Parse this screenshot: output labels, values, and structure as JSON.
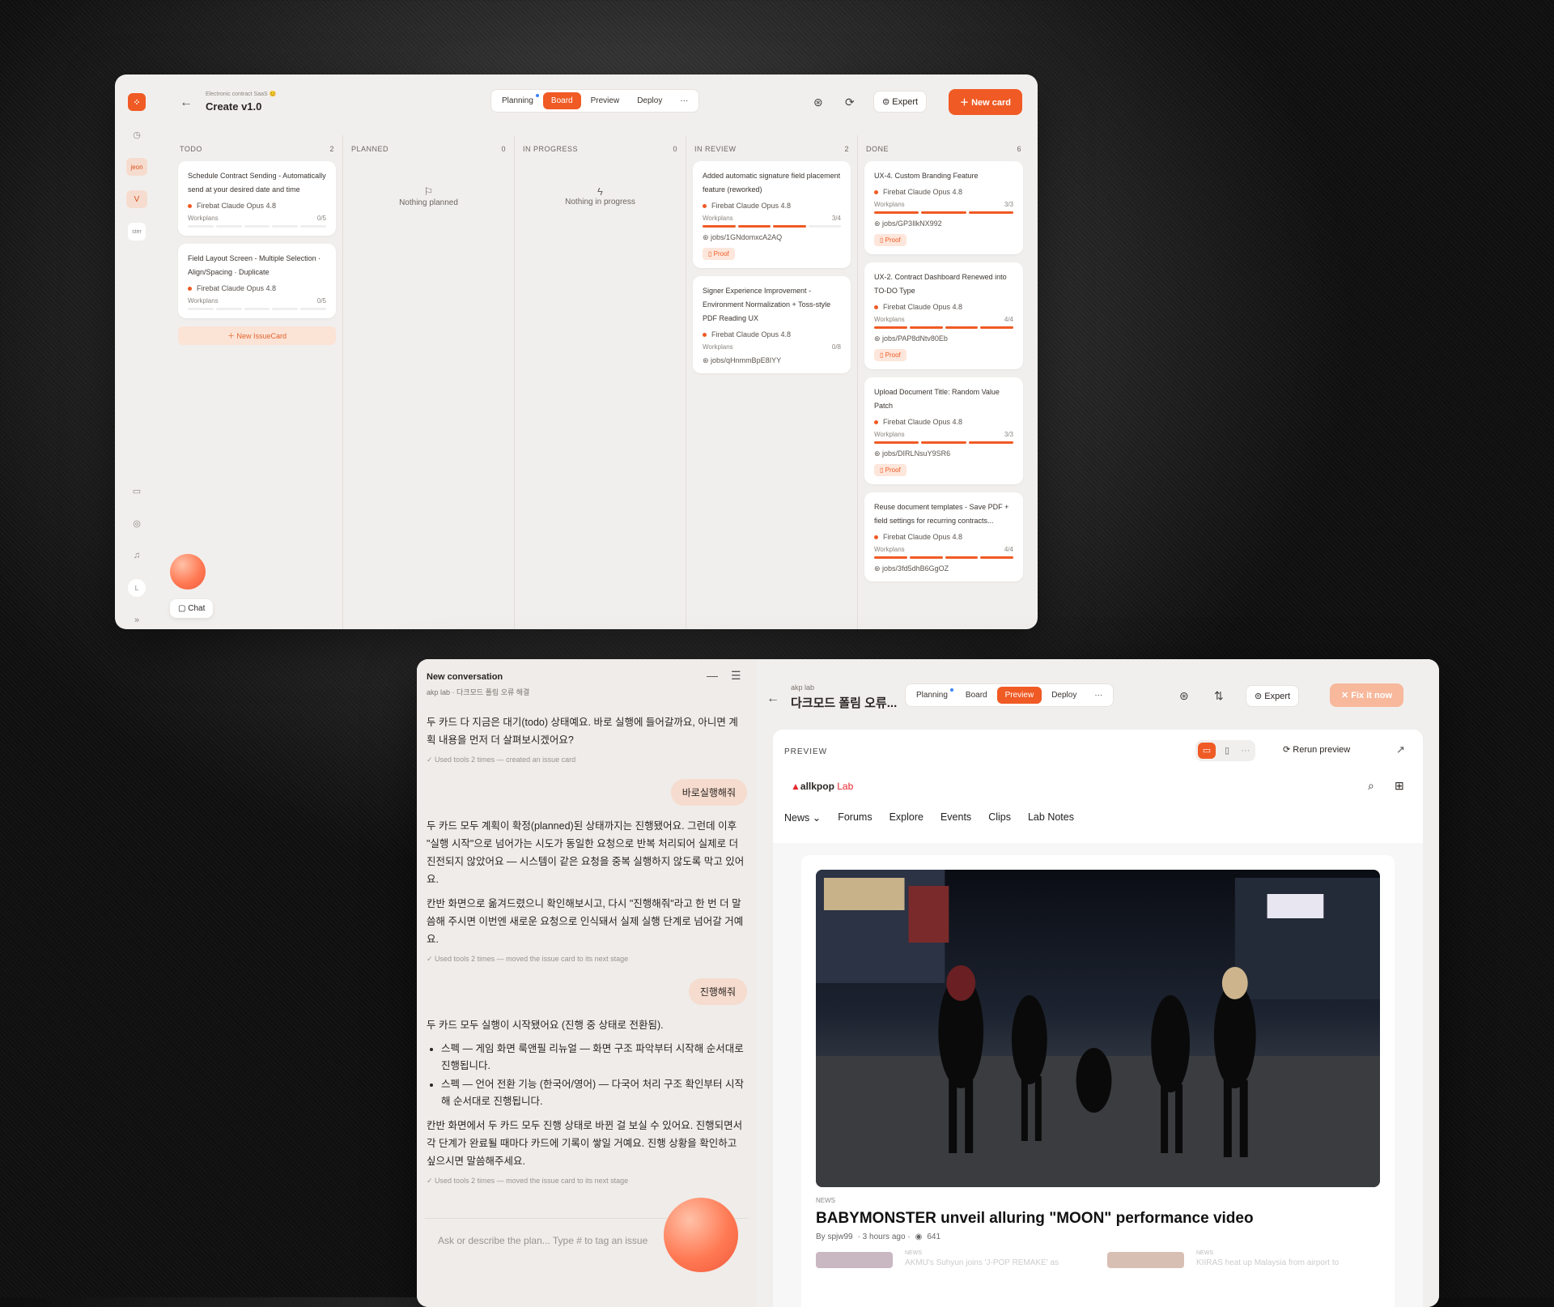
{
  "top": {
    "crumb": "Electronic contract SaaS 😊",
    "title": "Create v1.0",
    "tabs": [
      "Planning",
      "Board",
      "Preview",
      "Deploy",
      "···"
    ],
    "expert": "Expert",
    "new_card": "New card",
    "rail_labels": [
      "jeon",
      "V",
      "ster",
      "L"
    ],
    "chat_label": "Chat",
    "columns": [
      {
        "name": "TODO",
        "count": "2"
      },
      {
        "name": "PLANNED",
        "count": "0"
      },
      {
        "name": "IN PROGRESS",
        "count": "0"
      },
      {
        "name": "IN REVIEW",
        "count": "2"
      },
      {
        "name": "DONE",
        "count": "6"
      }
    ],
    "todo_cards": [
      {
        "title": "Schedule Contract Sending - Automatically send at your desired date and time",
        "model": "Firebat Claude Opus 4.8",
        "wp_label": "Workplans",
        "wp": "0/5"
      },
      {
        "title": "Field Layout Screen - Multiple Selection · Align/Spacing · Duplicate",
        "model": "Firebat Claude Opus 4.8",
        "wp_label": "Workplans",
        "wp": "0/5"
      }
    ],
    "new_issue": "New IssueCard",
    "empty_planned": "Nothing planned",
    "empty_progress": "Nothing in progress",
    "review_cards": [
      {
        "title": "Added automatic signature field placement feature (reworked)",
        "model": "Firebat Claude Opus 4.8",
        "wp_label": "Workplans",
        "wp": "3/4",
        "job": "jobs/1GNdomxcA2AQ",
        "proof": "Proof"
      },
      {
        "title": "Signer Experience Improvement - Environment Normalization + Toss-style PDF Reading UX",
        "model": "Firebat Claude Opus 4.8",
        "wp_label": "Workplans",
        "wp": "0/8",
        "job": "jobs/qHnmmBpE8IYY"
      }
    ],
    "done_cards": [
      {
        "title": "UX-4. Custom Branding Feature",
        "model": "Firebat Claude Opus 4.8",
        "wp_label": "Workplans",
        "wp": "3/3",
        "job": "jobs/GP3IlkNX992",
        "proof": "Proof"
      },
      {
        "title": "UX-2. Contract Dashboard Renewed into TO-DO Type",
        "model": "Firebat Claude Opus 4.8",
        "wp_label": "Workplans",
        "wp": "4/4",
        "job": "jobs/PAP8dNtv80Eb",
        "proof": "Proof"
      },
      {
        "title": "Upload Document Title: Random Value Patch",
        "model": "Firebat Claude Opus 4.8",
        "wp_label": "Workplans",
        "wp": "3/3",
        "job": "jobs/DIRLNsuY9SR6",
        "proof": "Proof"
      },
      {
        "title": "Reuse document templates - Save PDF + field settings for recurring contracts...",
        "model": "Firebat Claude Opus 4.8",
        "wp_label": "Workplans",
        "wp": "4/4",
        "job": "jobs/3fd5dhB6GgOZ"
      }
    ]
  },
  "conversation": {
    "title": "New conversation",
    "subtitle": "akp lab · 다크모드 폴림 오류 해결",
    "m1": "두 카드 다 지금은 대기(todo) 상태예요. 바로 실행에 들어갈까요, 아니면 계획 내용을 먼저 더 살펴보시겠어요?",
    "t1": "Used tools 2 times — created an issue card",
    "u1": "바로실행해줘",
    "m2": "두 카드 모두 계획이 확정(planned)된 상태까지는 진행됐어요. 그런데 이후 \"실행 시작\"으로 넘어가는 시도가 동일한 요청으로 반복 처리되어 실제로 더 진전되지 않았어요 — 시스템이 같은 요청을 중복 실행하지 않도록 막고 있어요.",
    "m3": "칸반 화면으로 옮겨드렸으니 확인해보시고, 다시 \"진행해줘\"라고 한 번 더 말씀해 주시면 이번엔 새로운 요청으로 인식돼서 실제 실행 단계로 넘어갈 거예요.",
    "t2": "Used tools 2 times — moved the issue card to its next stage",
    "u2": "진행해줘",
    "m4": "두 카드 모두 실행이 시작됐어요 (진행 중 상태로 전환됨).",
    "b1": "스펙 — 게임 화면 룩앤필 리뉴얼 — 화면 구조 파악부터 시작해 순서대로 진행됩니다.",
    "b2": "스펙 — 언어 전환 기능 (한국어/영어) — 다국어 처리 구조 확인부터 시작해 순서대로 진행됩니다.",
    "m5": "칸반 화면에서 두 카드 모두 진행 상태로 바뀐 걸 보실 수 있어요. 진행되면서 각 단계가 완료될 때마다 카드에 기록이 쌓일 거예요. 진행 상황을 확인하고 싶으시면 말씀해주세요.",
    "t3": "Used tools 2 times — moved the issue card to its next stage",
    "placeholder": "Ask or describe the plan... Type # to tag an issue"
  },
  "preview_pane": {
    "crumb": "akp lab",
    "title": "다크모드 폴림 오류...",
    "tabs": [
      "Planning",
      "Board",
      "Preview",
      "Deploy",
      "···"
    ],
    "expert": "Expert",
    "fix": "Fix it now",
    "label": "PREVIEW",
    "rerun": "Rerun preview",
    "site_brand": "allkpop",
    "site_brand2": "Lab",
    "nav": [
      "News ⌄",
      "Forums",
      "Explore",
      "Events",
      "Clips",
      "Lab Notes"
    ],
    "kicker": "NEWS",
    "headline": "BABYMONSTER unveil alluring \"MOON\" performance video",
    "by": "By spjw99",
    "time": "· 3 hours ago ·",
    "views": "641",
    "rel1": "AKMU's Suhyun joins 'J-POP REMAKE' as",
    "rel2": "KIIRAS heat up Malaysia from airport to",
    "rel_kicker": "NEWS"
  }
}
